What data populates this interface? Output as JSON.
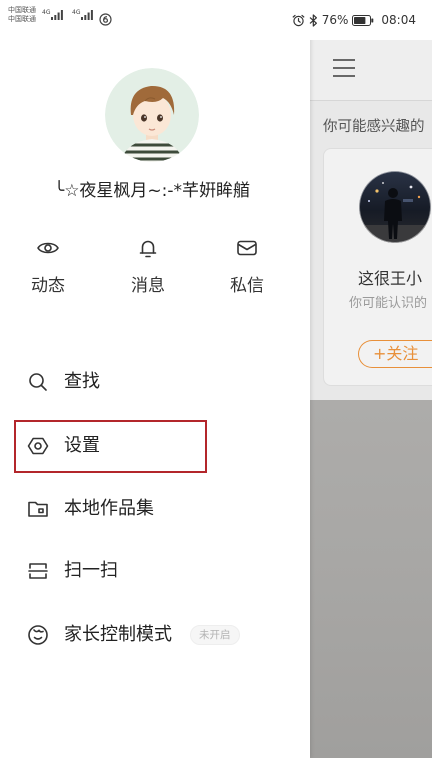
{
  "status_bar": {
    "carrier_1": "中国联通",
    "carrier_2": "中国联通",
    "network_1": "4G",
    "network_2": "4G",
    "battery_percent": "76%",
    "time": "08:04",
    "icons": [
      "signal-icon",
      "app-notification-icon",
      "alarm-icon",
      "bluetooth-icon",
      "battery-icon"
    ]
  },
  "drawer": {
    "profile": {
      "username": "╰☆夜星枫月~:-*芊姸眸艏",
      "avatar_icon": "cartoon-boy-avatar"
    },
    "quick_actions": [
      {
        "label": "动态",
        "icon": "eye-icon"
      },
      {
        "label": "消息",
        "icon": "bell-icon"
      },
      {
        "label": "私信",
        "icon": "mail-icon"
      }
    ],
    "menu": [
      {
        "label": "查找",
        "icon": "search-icon"
      },
      {
        "label": "设置",
        "icon": "settings-icon",
        "highlighted": true
      },
      {
        "label": "本地作品集",
        "icon": "folder-icon"
      },
      {
        "label": "扫一扫",
        "icon": "scan-icon"
      },
      {
        "label": "家长控制模式",
        "icon": "child-face-icon",
        "badge": "未开启"
      }
    ],
    "highlight_color": "#b3262b"
  },
  "main": {
    "menu_icon": "hamburger-icon",
    "suggestions_title": "你可能感兴趣的",
    "suggestion_card": {
      "name": "这很王小",
      "subtitle": "你可能认识的",
      "follow_label": "+关注"
    },
    "accent_color": "#e8903a"
  }
}
